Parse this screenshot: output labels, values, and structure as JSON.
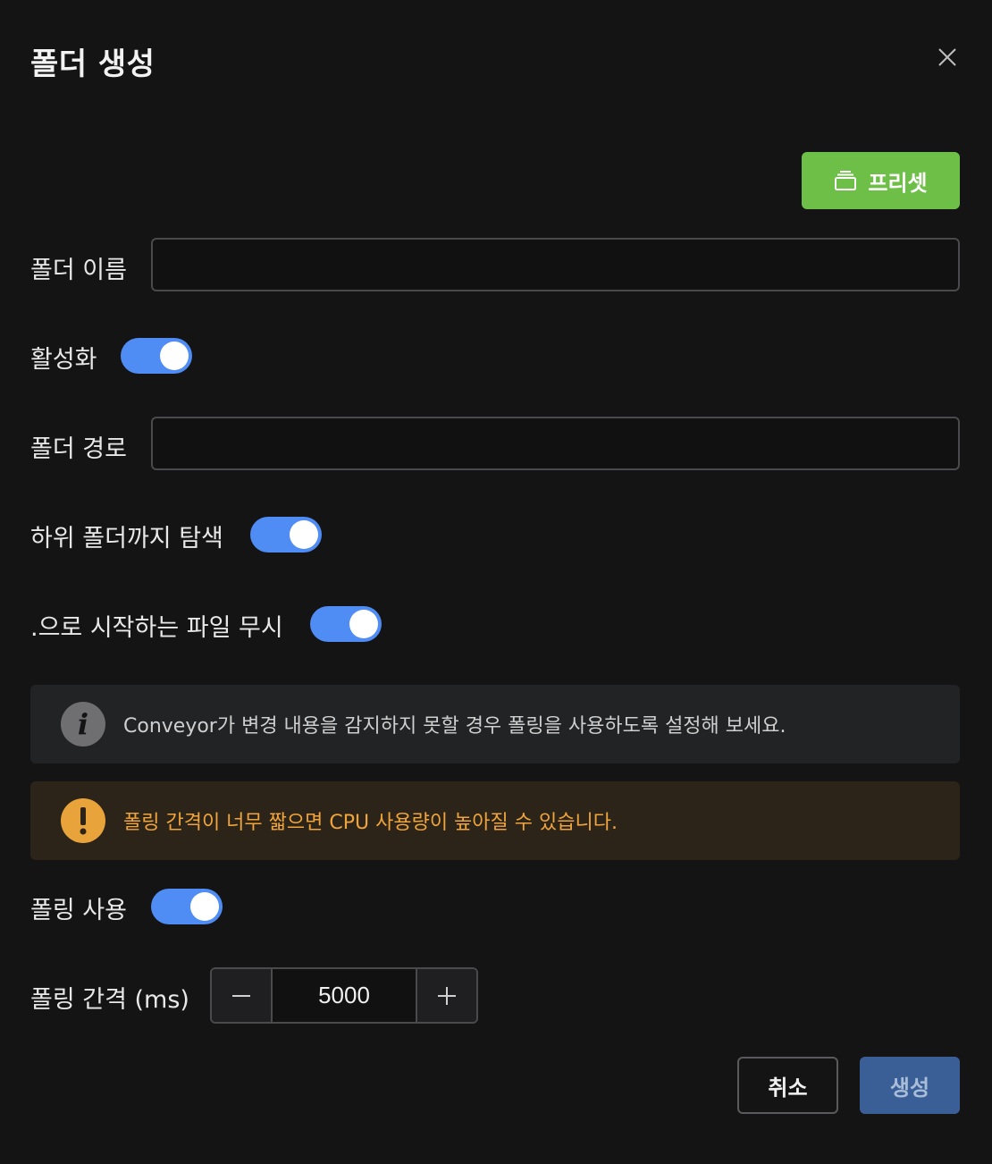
{
  "dialog": {
    "title": "폴더 생성"
  },
  "preset": {
    "label": "프리셋",
    "icon": "folder-stack-icon"
  },
  "fields": {
    "folder_name": {
      "label": "폴더 이름",
      "value": "",
      "placeholder": ""
    },
    "enabled": {
      "label": "활성화",
      "checked": true
    },
    "folder_path": {
      "label": "폴더 경로",
      "value": "",
      "placeholder": ""
    },
    "recursive": {
      "label": "하위 폴더까지 탐색",
      "checked": true
    },
    "ignore_dotfiles": {
      "label": ".으로 시작하는 파일 무시",
      "checked": true
    },
    "polling": {
      "label": "폴링 사용",
      "checked": true
    },
    "polling_interval": {
      "label": "폴링 간격 (ms)",
      "value": "5000"
    }
  },
  "alerts": {
    "info": {
      "text": "Conveyor가 변경 내용을 감지하지 못할 경우 폴링을 사용하도록 설정해 보세요.",
      "icon": "info-icon"
    },
    "warning": {
      "text": "폴링 간격이 너무 짧으면 CPU 사용량이 높아질 수 있습니다.",
      "icon": "warning-icon"
    }
  },
  "actions": {
    "cancel": "취소",
    "create": "생성"
  },
  "colors": {
    "background": "#141414",
    "accent_toggle": "#4f8cf3",
    "preset_button": "#6dbf47",
    "create_button": "#3a5f97",
    "warning": "#efa53c"
  }
}
